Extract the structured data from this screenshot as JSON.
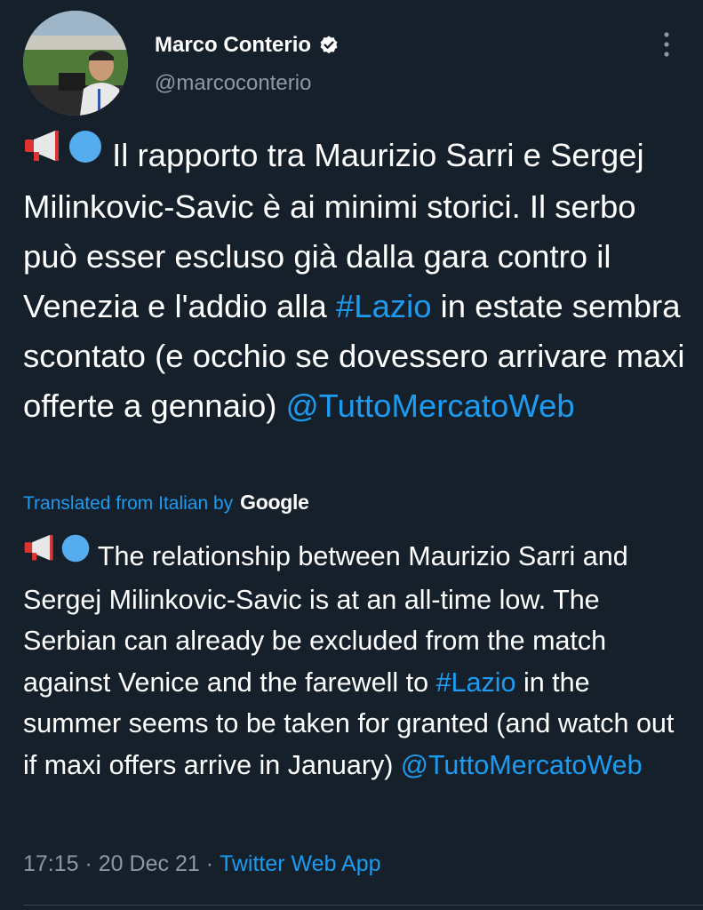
{
  "author": {
    "display_name": "Marco Conterio",
    "handle": "@marcoconterio",
    "verified": true
  },
  "tweet": {
    "emoji_prefix": [
      "megaphone",
      "blue-circle"
    ],
    "text_part1": " Il rapporto tra Maurizio Sarri e Sergej Milinkovic-Savic è ai minimi storici. Il serbo può esser escluso già dalla gara contro il Venezia e l'addio alla ",
    "hashtag": "#Lazio",
    "text_part2": " in estate sembra scontato (e occhio se dovessero arrivare maxi offerte a gennaio) ",
    "mention": "@TuttoMercatoWeb"
  },
  "translation": {
    "label": "Translated from Italian by",
    "provider": "Google",
    "text_part1": " The relationship between Maurizio Sarri and Sergej Milinkovic-Savic is at an all-time low. The Serbian can already be excluded from the match against Venice and the farewell to ",
    "hashtag": "#Lazio",
    "text_part2": " in the summer seems to be taken for granted (and watch out if maxi offers arrive in January) ",
    "mention": "@TuttoMercatoWeb"
  },
  "meta": {
    "time": "17:15",
    "separator": " · ",
    "date": "20 Dec 21",
    "app": "Twitter Web App"
  },
  "icons": {
    "more": "more-vertical-icon",
    "verified": "verified-badge-icon",
    "megaphone": "megaphone-icon",
    "circle": "blue-circle-icon"
  },
  "colors": {
    "background": "#15202b",
    "accent": "#1d9bf0",
    "secondary_text": "#8b98a5"
  }
}
